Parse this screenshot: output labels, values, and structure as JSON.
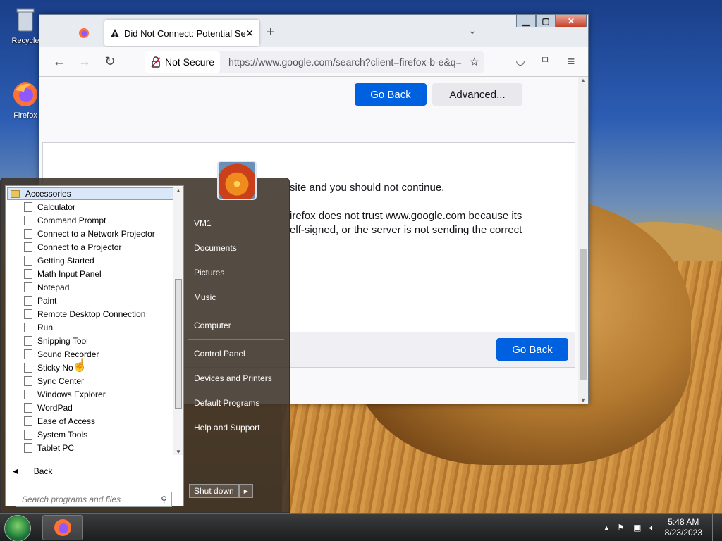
{
  "desktop": {
    "icons": [
      {
        "label": "Recycle"
      },
      {
        "label": "Firefox"
      }
    ]
  },
  "browser": {
    "tab_title": "Did Not Connect: Potential Sec",
    "security_label": "Not Secure",
    "url": "https://www.google.com/search?client=firefox-b-e&q=",
    "top_go_back": "Go Back",
    "advanced_label": "Advanced...",
    "adv_line1": "site and you should not continue.",
    "adv_line2": "irefox does not trust www.google.com because its",
    "adv_line3": "elf-signed, or the server is not sending the correct",
    "bottom_go_back": "Go Back"
  },
  "start_menu": {
    "folder": "Accessories",
    "programs": [
      "Calculator",
      "Command Prompt",
      "Connect to a Network Projector",
      "Connect to a Projector",
      "Getting Started",
      "Math Input Panel",
      "Notepad",
      "Paint",
      "Remote Desktop Connection",
      "Run",
      "Snipping Tool",
      "Sound Recorder",
      "Sticky No",
      "Sync Center",
      "Windows Explorer",
      "WordPad",
      "Ease of Access",
      "System Tools",
      "Tablet PC"
    ],
    "back_label": "Back",
    "search_placeholder": "Search programs and files",
    "right_items": [
      "VM1",
      "Documents",
      "Pictures",
      "Music",
      "Computer",
      "Control Panel",
      "Devices and Printers",
      "Default Programs",
      "Help and Support"
    ],
    "shutdown_label": "Shut down"
  },
  "taskbar": {
    "time": "5:48 AM",
    "date": "8/23/2023"
  }
}
